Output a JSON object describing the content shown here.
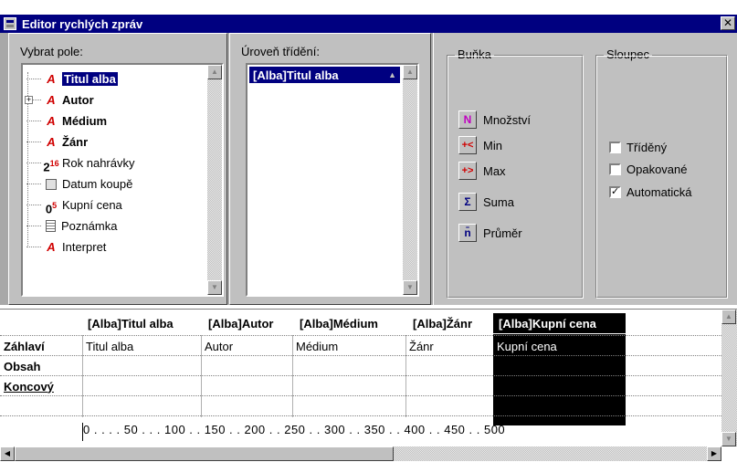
{
  "window": {
    "title": "Editor rychlých zpráv",
    "close_glyph": "✕"
  },
  "fields_panel": {
    "label": "Vybrat pole:",
    "items": [
      {
        "label": "Titul alba",
        "icon": "text-field-icon",
        "selected": true,
        "bold": true
      },
      {
        "label": "Autor",
        "icon": "text-field-icon",
        "bold": true,
        "expandable": true
      },
      {
        "label": "Médium",
        "icon": "text-field-icon",
        "bold": true
      },
      {
        "label": "Žánr",
        "icon": "text-field-icon",
        "bold": true
      },
      {
        "label": "Rok nahrávky",
        "icon": "number-field-icon"
      },
      {
        "label": "Datum koupě",
        "icon": "date-field-icon"
      },
      {
        "label": "Kupní cena",
        "icon": "currency-field-icon"
      },
      {
        "label": "Poznámka",
        "icon": "memo-field-icon"
      },
      {
        "label": "Interpret",
        "icon": "text-field-icon"
      }
    ]
  },
  "sort_panel": {
    "label": "Úroveň třídění:",
    "items": [
      {
        "label": "[Alba]Titul alba"
      }
    ]
  },
  "cell_group": {
    "legend": "Buňka",
    "buttons": [
      {
        "label": "Množství",
        "glyph": "N",
        "icon": "count-icon"
      },
      {
        "label": "Min",
        "glyph": "+<",
        "icon": "min-icon"
      },
      {
        "label": "Max",
        "glyph": "+>",
        "icon": "max-icon"
      },
      {
        "label": "Suma",
        "glyph": "Σ",
        "icon": "sum-icon"
      },
      {
        "label": "Průměr",
        "glyph": "n̄",
        "icon": "average-icon"
      }
    ]
  },
  "column_group": {
    "legend": "Sloupec",
    "options": [
      {
        "label": "Tříděný",
        "checked": false
      },
      {
        "label": "Opakované",
        "checked": false
      },
      {
        "label": "Automatická",
        "checked": true
      }
    ]
  },
  "grid": {
    "columns": [
      "[Alba]Titul alba",
      "[Alba]Autor",
      "[Alba]Médium",
      "[Alba]Žánr",
      "[Alba]Kupní cena"
    ],
    "rows": [
      "Záhlaví",
      "Obsah",
      "Koncový"
    ],
    "header_cells": [
      "Titul alba",
      "Autor",
      "Médium",
      "Žánr",
      "Kupní cena"
    ],
    "ruler": "0 . . . . 50 . . . 100 . . 150 . . 200 . . 250 . . 300 . . 350 . . 400 . . 450 . . 500"
  }
}
